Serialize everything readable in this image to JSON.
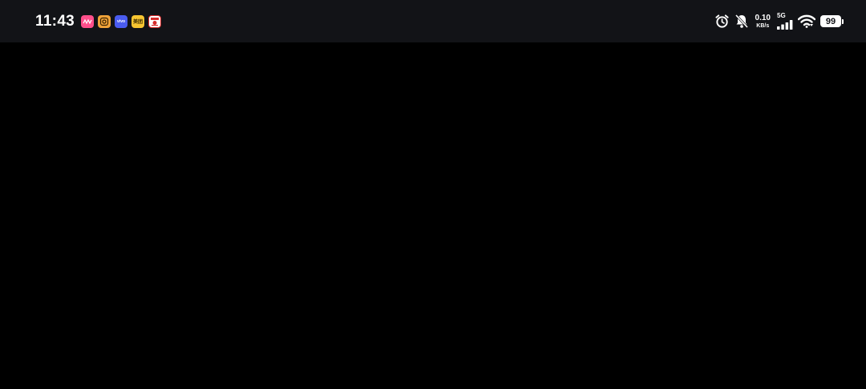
{
  "status_bar": {
    "time": "11:43",
    "notification_icons": [
      {
        "icon": "pink-app-icon",
        "color": "#ff4f8b"
      },
      {
        "icon": "instagram-like-app-icon",
        "color": "#f0a33a"
      },
      {
        "icon": "vivo-app-icon",
        "color": "#4a5cf0",
        "label": "vivo"
      },
      {
        "icon": "meituan-app-icon",
        "color": "#f7c531",
        "label": "美团"
      },
      {
        "icon": "kfc-app-icon",
        "color": "#d52b2b"
      }
    ],
    "system_icons": [
      "alarm-icon",
      "bell-muted-icon"
    ],
    "net_speed": {
      "value": "0.10",
      "unit": "KB/s"
    },
    "network_type": "5G",
    "battery": "99"
  },
  "colors": {
    "status_bar_bg": "#121317",
    "screen_bg": "#000000"
  }
}
